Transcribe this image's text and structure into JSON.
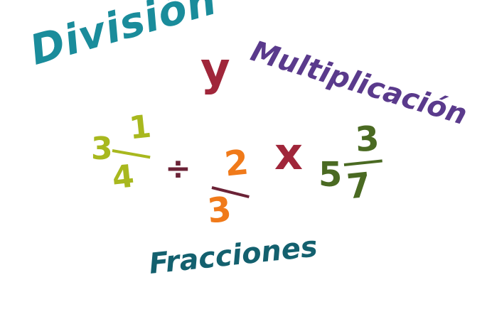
{
  "title": {
    "division": "División",
    "conjunction": "y",
    "multiplication": "Multiplicación",
    "subject": "Fracciones"
  },
  "expression": {
    "mixed1": {
      "whole": "3",
      "numerator": "1",
      "denominator": "4"
    },
    "divide_symbol": "÷",
    "fraction2": {
      "numerator": "2",
      "denominator": "3"
    },
    "times_symbol": "x",
    "mixed3": {
      "whole": "5",
      "numerator": "3",
      "denominator": "7"
    }
  },
  "colors": {
    "division": "#1a8c9b",
    "conjunction": "#a0263a",
    "multiplication": "#5a3a8c",
    "subject": "#13606e",
    "mixed1": "#a8b81e",
    "divide_symbol": "#6b2236",
    "fraction2": "#f07a1a",
    "times_symbol": "#a0263a",
    "mixed3": "#4a6a22"
  }
}
